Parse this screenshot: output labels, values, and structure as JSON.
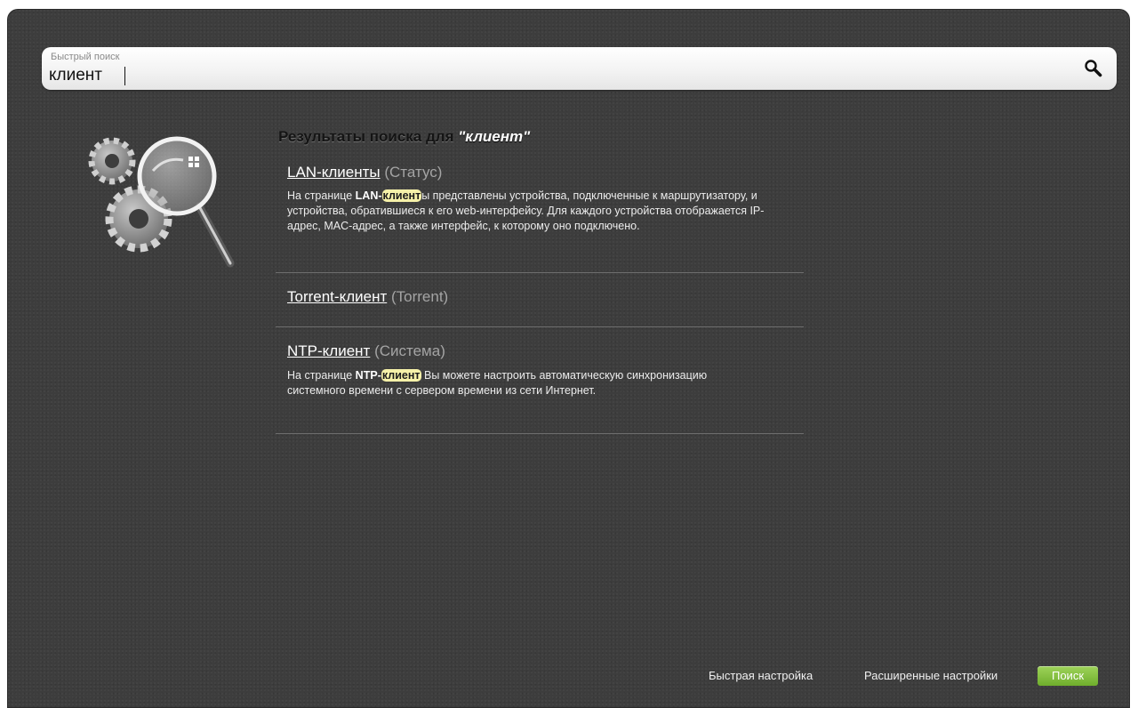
{
  "search": {
    "label": "Быстрый поиск",
    "value": "клиент"
  },
  "results": {
    "title_prefix": "Результаты поиска для",
    "query_display": "\"клиент\"",
    "items": [
      {
        "link": "LAN-клиенты",
        "category": "(Статус)",
        "desc_before": "На странице ",
        "desc_bold": "LAN-",
        "desc_highlight": "клиент",
        "desc_after": "ы представлены устройства, подключенные к маршрутизатору, и устройства, обратившиеся к его web-интерфейсу. Для каждого устройства отображается IP-адрес, MAC-адрес, а также интерфейс, к которому оно подключено."
      },
      {
        "link": "Torrent-клиент",
        "category": "(Torrent)"
      },
      {
        "link": "NTP-клиент",
        "category": "(Система)",
        "desc_before": "На странице ",
        "desc_bold": "NTP-",
        "desc_highlight": "клиент",
        "desc_after": " Вы можете настроить автоматическую синхронизацию системного времени с сервером времени из сети Интернет."
      }
    ]
  },
  "footer": {
    "quick_setup": "Быстрая настройка",
    "advanced_settings": "Расширенные настройки",
    "search_button": "Поиск"
  },
  "colors": {
    "background": "#3d3d3d",
    "highlight": "#f6f1a9",
    "accent_button": "#7dbd3a"
  },
  "icons": {
    "search": "magnifier-icon",
    "illustration": "gears-magnifier-illustration"
  }
}
